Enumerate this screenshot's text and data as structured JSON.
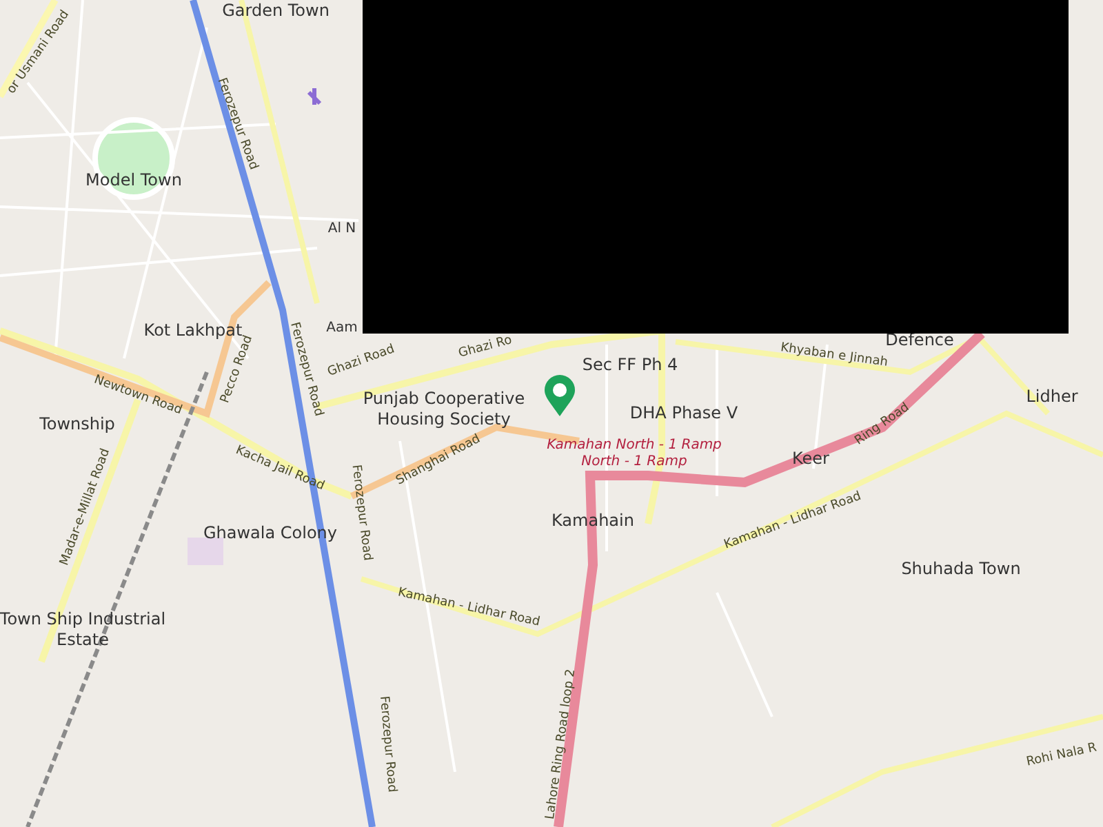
{
  "map": {
    "places": [
      {
        "text": "Garden Town"
      },
      {
        "text": "Model Town"
      },
      {
        "text": "Al N"
      },
      {
        "text": "Kot Lakhpat"
      },
      {
        "text": "Aam"
      },
      {
        "text": "Township"
      },
      {
        "text": "Ghawala Colony"
      },
      {
        "text": "Town Ship Industrial Estate"
      },
      {
        "text": "Punjab Cooperative Housing Society"
      },
      {
        "text": "Sec FF Ph 4"
      },
      {
        "text": "DHA Phase V"
      },
      {
        "text": "Kamahain"
      },
      {
        "text": "Keer"
      },
      {
        "text": "Defence"
      },
      {
        "text": "Lidher"
      },
      {
        "text": "Shuhada Town"
      }
    ],
    "road_labels": [
      {
        "text": "or Usmani Road",
        "kind": "road"
      },
      {
        "text": "Ferozepur Road",
        "kind": "road"
      },
      {
        "text": "Ferozepur Road",
        "kind": "road"
      },
      {
        "text": "Ferozepur Road",
        "kind": "road"
      },
      {
        "text": "Ferozepur Road",
        "kind": "road"
      },
      {
        "text": "Newtown Road",
        "kind": "road"
      },
      {
        "text": "Pecco Road",
        "kind": "road"
      },
      {
        "text": "Ghazi Road",
        "kind": "road"
      },
      {
        "text": "Ghazi Ro",
        "kind": "road"
      },
      {
        "text": "Kacha Jail Road",
        "kind": "road"
      },
      {
        "text": "Madar-e-Millat Road",
        "kind": "road"
      },
      {
        "text": "Shanghai Road",
        "kind": "road"
      },
      {
        "text": "Kamahan - Lidhar Road",
        "kind": "road"
      },
      {
        "text": "Kamahan - Lidhar Road",
        "kind": "road"
      },
      {
        "text": "Khyaban e Jinnah",
        "kind": "road"
      },
      {
        "text": "Ring Road",
        "kind": "road"
      },
      {
        "text": "Lahore Ring Road loop 2",
        "kind": "road"
      },
      {
        "text": "Rohi Nala R",
        "kind": "road"
      },
      {
        "text": "Kamahan North - 1 Ramp",
        "kind": "ramp"
      },
      {
        "text": "North - 1 Ramp",
        "kind": "ramp"
      }
    ]
  }
}
